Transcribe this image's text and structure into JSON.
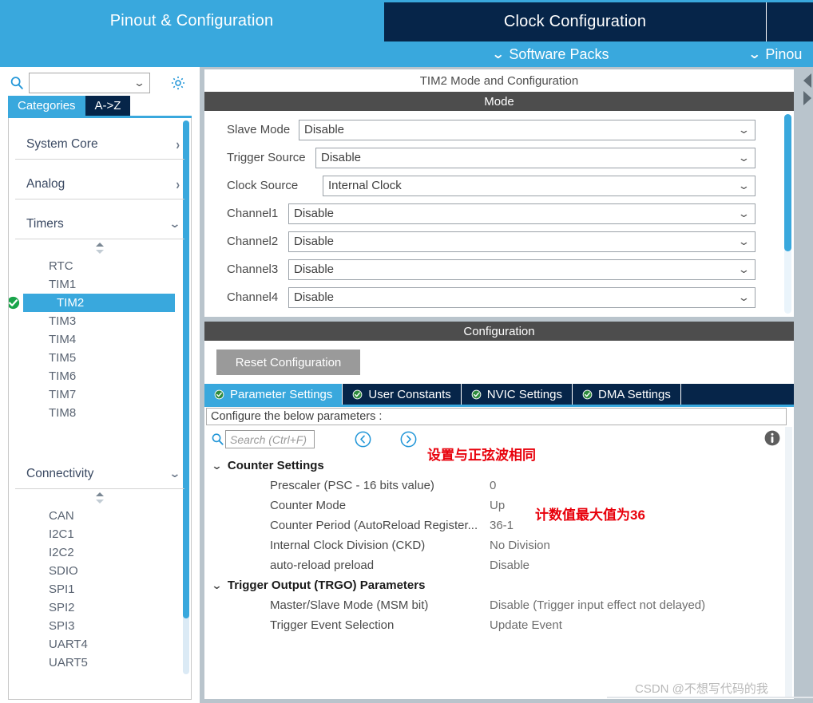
{
  "ribbon": {
    "tabs": [
      {
        "label": "Pinout & Configuration",
        "active": true
      },
      {
        "label": "Clock Configuration",
        "active": false
      }
    ],
    "menu": [
      {
        "label": "Software Packs",
        "icon": "chevron-down-icon"
      },
      {
        "label": "Pinou",
        "icon": "chevron-down-icon"
      }
    ]
  },
  "sidebar": {
    "search": {
      "value": "",
      "placeholder": ""
    },
    "gear_icon": "gear-icon",
    "search_icon": "search-icon",
    "tabs": [
      {
        "label": "Categories",
        "active": true
      },
      {
        "label": "A->Z",
        "active": false
      }
    ],
    "groups": [
      {
        "name": "System Core",
        "expanded": false,
        "icon": "chevron-right-icon",
        "items": []
      },
      {
        "name": "Analog",
        "expanded": false,
        "icon": "chevron-right-icon",
        "items": []
      },
      {
        "name": "Timers",
        "expanded": true,
        "icon": "chevron-down-icon",
        "items": [
          {
            "label": "RTC",
            "selected": false,
            "configured": false
          },
          {
            "label": "TIM1",
            "selected": false,
            "configured": false
          },
          {
            "label": "TIM2",
            "selected": true,
            "configured": true
          },
          {
            "label": "TIM3",
            "selected": false,
            "configured": false
          },
          {
            "label": "TIM4",
            "selected": false,
            "configured": false
          },
          {
            "label": "TIM5",
            "selected": false,
            "configured": false
          },
          {
            "label": "TIM6",
            "selected": false,
            "configured": false
          },
          {
            "label": "TIM7",
            "selected": false,
            "configured": false
          },
          {
            "label": "TIM8",
            "selected": false,
            "configured": false
          }
        ]
      },
      {
        "name": "Connectivity",
        "expanded": true,
        "icon": "chevron-down-icon",
        "items": [
          {
            "label": "CAN",
            "selected": false,
            "configured": false
          },
          {
            "label": "I2C1",
            "selected": false,
            "configured": false
          },
          {
            "label": "I2C2",
            "selected": false,
            "configured": false
          },
          {
            "label": "SDIO",
            "selected": false,
            "configured": false
          },
          {
            "label": "SPI1",
            "selected": false,
            "configured": false
          },
          {
            "label": "SPI2",
            "selected": false,
            "configured": false
          },
          {
            "label": "SPI3",
            "selected": false,
            "configured": false
          },
          {
            "label": "UART4",
            "selected": false,
            "configured": false
          },
          {
            "label": "UART5",
            "selected": false,
            "configured": false
          }
        ]
      }
    ]
  },
  "mode_panel": {
    "title": "TIM2 Mode and Configuration",
    "section_header": "Mode",
    "fields": [
      {
        "label": "Slave Mode",
        "value": "Disable"
      },
      {
        "label": "Trigger Source",
        "value": "Disable"
      },
      {
        "label": "Clock Source",
        "value": "Internal Clock"
      },
      {
        "label": "Channel1",
        "value": "Disable"
      },
      {
        "label": "Channel2",
        "value": "Disable"
      },
      {
        "label": "Channel3",
        "value": "Disable"
      },
      {
        "label": "Channel4",
        "value": "Disable"
      }
    ]
  },
  "config_panel": {
    "section_header": "Configuration",
    "reset_button": "Reset Configuration",
    "tabs": [
      {
        "label": "Parameter Settings",
        "active": true,
        "icon": "check-circle-icon"
      },
      {
        "label": "User Constants",
        "active": false,
        "icon": "check-circle-icon"
      },
      {
        "label": "NVIC Settings",
        "active": false,
        "icon": "check-circle-icon"
      },
      {
        "label": "DMA Settings",
        "active": false,
        "icon": "check-circle-icon"
      }
    ],
    "hint": "Configure the below parameters :",
    "search": {
      "placeholder": "Search (Ctrl+F)",
      "value": "",
      "icon": "search-icon"
    },
    "nav_prev_icon": "chevron-left-circle-icon",
    "nav_next_icon": "chevron-right-circle-icon",
    "info_icon": "info-icon",
    "groups": [
      {
        "name": "Counter Settings",
        "expanded": true,
        "icon": "chevron-down-icon",
        "params": [
          {
            "name": "Prescaler (PSC - 16 bits value)",
            "value": "0"
          },
          {
            "name": "Counter Mode",
            "value": "Up"
          },
          {
            "name": "Counter Period (AutoReload Register...",
            "value": "36-1"
          },
          {
            "name": "Internal Clock Division (CKD)",
            "value": "No Division"
          },
          {
            "name": "auto-reload preload",
            "value": "Disable"
          }
        ]
      },
      {
        "name": "Trigger Output (TRGO) Parameters",
        "expanded": true,
        "icon": "chevron-down-icon",
        "params": [
          {
            "name": "Master/Slave Mode (MSM bit)",
            "value": "Disable (Trigger input effect not delayed)"
          },
          {
            "name": "Trigger Event Selection",
            "value": "Update Event"
          }
        ]
      }
    ]
  },
  "annotations": [
    {
      "text": "设置与正弦波相同",
      "color": "#e8000b"
    },
    {
      "text": "计数值最大值为36",
      "color": "#e8000b"
    }
  ],
  "watermark": {
    "text": "CSDN @不想写代码的我"
  },
  "colors": {
    "accent_blue": "#39a8dd",
    "dark_navy": "#062549",
    "header_gray": "#4d4d4d",
    "annotation_red": "#e8000b"
  }
}
